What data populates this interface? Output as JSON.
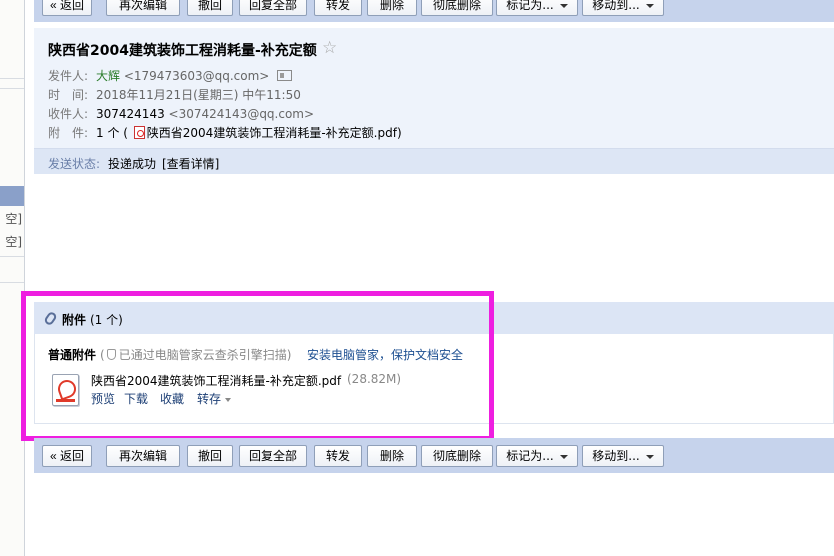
{
  "toolbar": {
    "back": "« 返回",
    "edit_again": "再次编辑",
    "recall": "撤回",
    "reply_all": "回复全部",
    "forward": "转发",
    "delete": "删除",
    "delete_forever": "彻底删除",
    "mark_as": "标记为...",
    "move_to": "移动到..."
  },
  "sidebar": {
    "frag1": "空]",
    "frag2": "空]"
  },
  "mail": {
    "subject": "陕西省2004建筑装饰工程消耗量-补充定额",
    "star": "☆",
    "sender_label": "发件人:",
    "sender_name": "大辉",
    "sender_email": "<179473603@qq.com>",
    "time_label": "时　间:",
    "time_value": "2018年11月21日(星期三) 中午11:50",
    "recipient_label": "收件人:",
    "recipient_name": "307424143",
    "recipient_email": "<307424143@qq.com>",
    "attach_label": "附　件:",
    "attach_prefix": "1 个 (",
    "attach_file": "陕西省2004建筑装饰工程消耗量-补充定额.pdf",
    "attach_suffix": ")",
    "status_label": "发送状态:",
    "status_value": "投递成功",
    "status_link": "[查看详情]"
  },
  "attachments": {
    "title": "附件",
    "count": "(1 个)",
    "normal_label": "普通附件",
    "scan_open": "(",
    "scan_note": "已通过电脑管家云查杀引擎扫描)",
    "install_link": "安装电脑管家，保护文档安全",
    "file_name": "陕西省2004建筑装饰工程消耗量-补充定额.pdf",
    "file_size": "(28.82M)",
    "actions": {
      "preview": "预览",
      "download": "下载",
      "favorite": "收藏",
      "save_to": "转存"
    }
  },
  "colors": {
    "toolbar_bg": "#c6d3ec",
    "header_bg": "#eef3fb",
    "highlight": "#ee1ee0",
    "sender_name": "#2c7d2c",
    "link": "#1d4f91"
  }
}
